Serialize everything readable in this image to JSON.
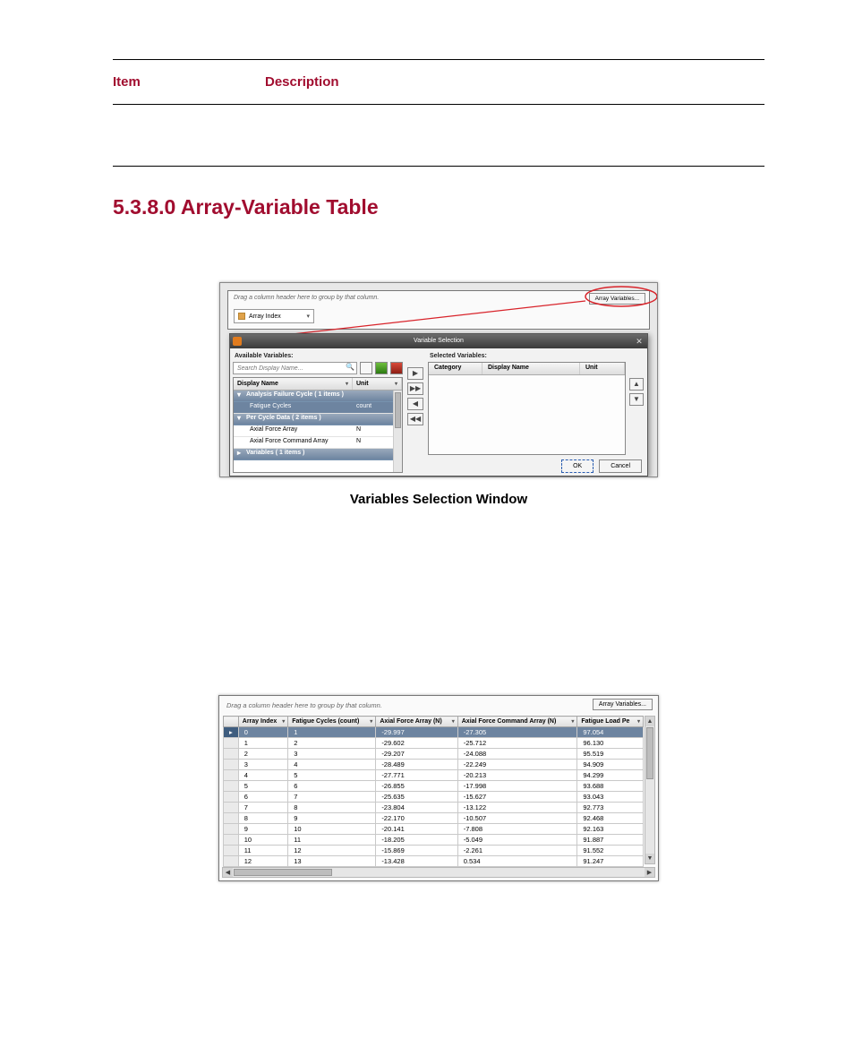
{
  "desc_table": {
    "col1": "Item",
    "col2": "Description"
  },
  "section_heading": "5.3.8.0 Array-Variable Table",
  "fig1_caption": "Variables Selection Window",
  "shot1": {
    "drag_hint": "Drag a column header here to group by that column.",
    "array_index_chip": "Array Index",
    "array_variables_btn": "Array Variables...",
    "dialog_title": "Variable Selection",
    "available_label": "Available Variables:",
    "selected_label": "Selected Variables:",
    "search_placeholder": "Search Display Name...",
    "tree_header": {
      "name": "Display Name",
      "unit": "Unit"
    },
    "groups": [
      {
        "label": "Analysis Failure Cycle ( 1 items )",
        "open": true,
        "rows": [
          {
            "name": "Fatigue Cycles",
            "unit": "count",
            "selected": true
          }
        ]
      },
      {
        "label": "Per Cycle Data ( 2 items )",
        "open": true,
        "rows": [
          {
            "name": "Axial Force Array",
            "unit": "N"
          },
          {
            "name": "Axial Force Command Array",
            "unit": "N"
          }
        ]
      },
      {
        "label": "Variables ( 1 items )",
        "open": false,
        "rows": []
      }
    ],
    "selected_header": {
      "category": "Category",
      "display": "Display Name",
      "unit": "Unit"
    },
    "ok": "OK",
    "cancel": "Cancel"
  },
  "shot2": {
    "drag_hint": "Drag a column header here to group by that column.",
    "array_variables_btn": "Array Variables...",
    "columns": [
      "Array Index",
      "Fatigue Cycles (count)",
      "Axial Force Array (N)",
      "Axial Force Command Array (N)",
      "Fatigue Load Pe"
    ],
    "rows": [
      [
        "0",
        "1",
        "-29.997",
        "-27.305",
        "97.054"
      ],
      [
        "1",
        "2",
        "-29.602",
        "-25.712",
        "96.130"
      ],
      [
        "2",
        "3",
        "-29.207",
        "-24.088",
        "95.519"
      ],
      [
        "3",
        "4",
        "-28.489",
        "-22.249",
        "94.909"
      ],
      [
        "4",
        "5",
        "-27.771",
        "-20.213",
        "94.299"
      ],
      [
        "5",
        "6",
        "-26.855",
        "-17.998",
        "93.688"
      ],
      [
        "6",
        "7",
        "-25.635",
        "-15.627",
        "93.043"
      ],
      [
        "7",
        "8",
        "-23.804",
        "-13.122",
        "92.773"
      ],
      [
        "8",
        "9",
        "-22.170",
        "-10.507",
        "92.468"
      ],
      [
        "9",
        "10",
        "-20.141",
        "-7.808",
        "92.163"
      ],
      [
        "10",
        "11",
        "-18.205",
        "-5.049",
        "91.887"
      ],
      [
        "11",
        "12",
        "-15.869",
        "-2.261",
        "91.552"
      ],
      [
        "12",
        "13",
        "-13.428",
        "0.534",
        "91.247"
      ]
    ]
  }
}
